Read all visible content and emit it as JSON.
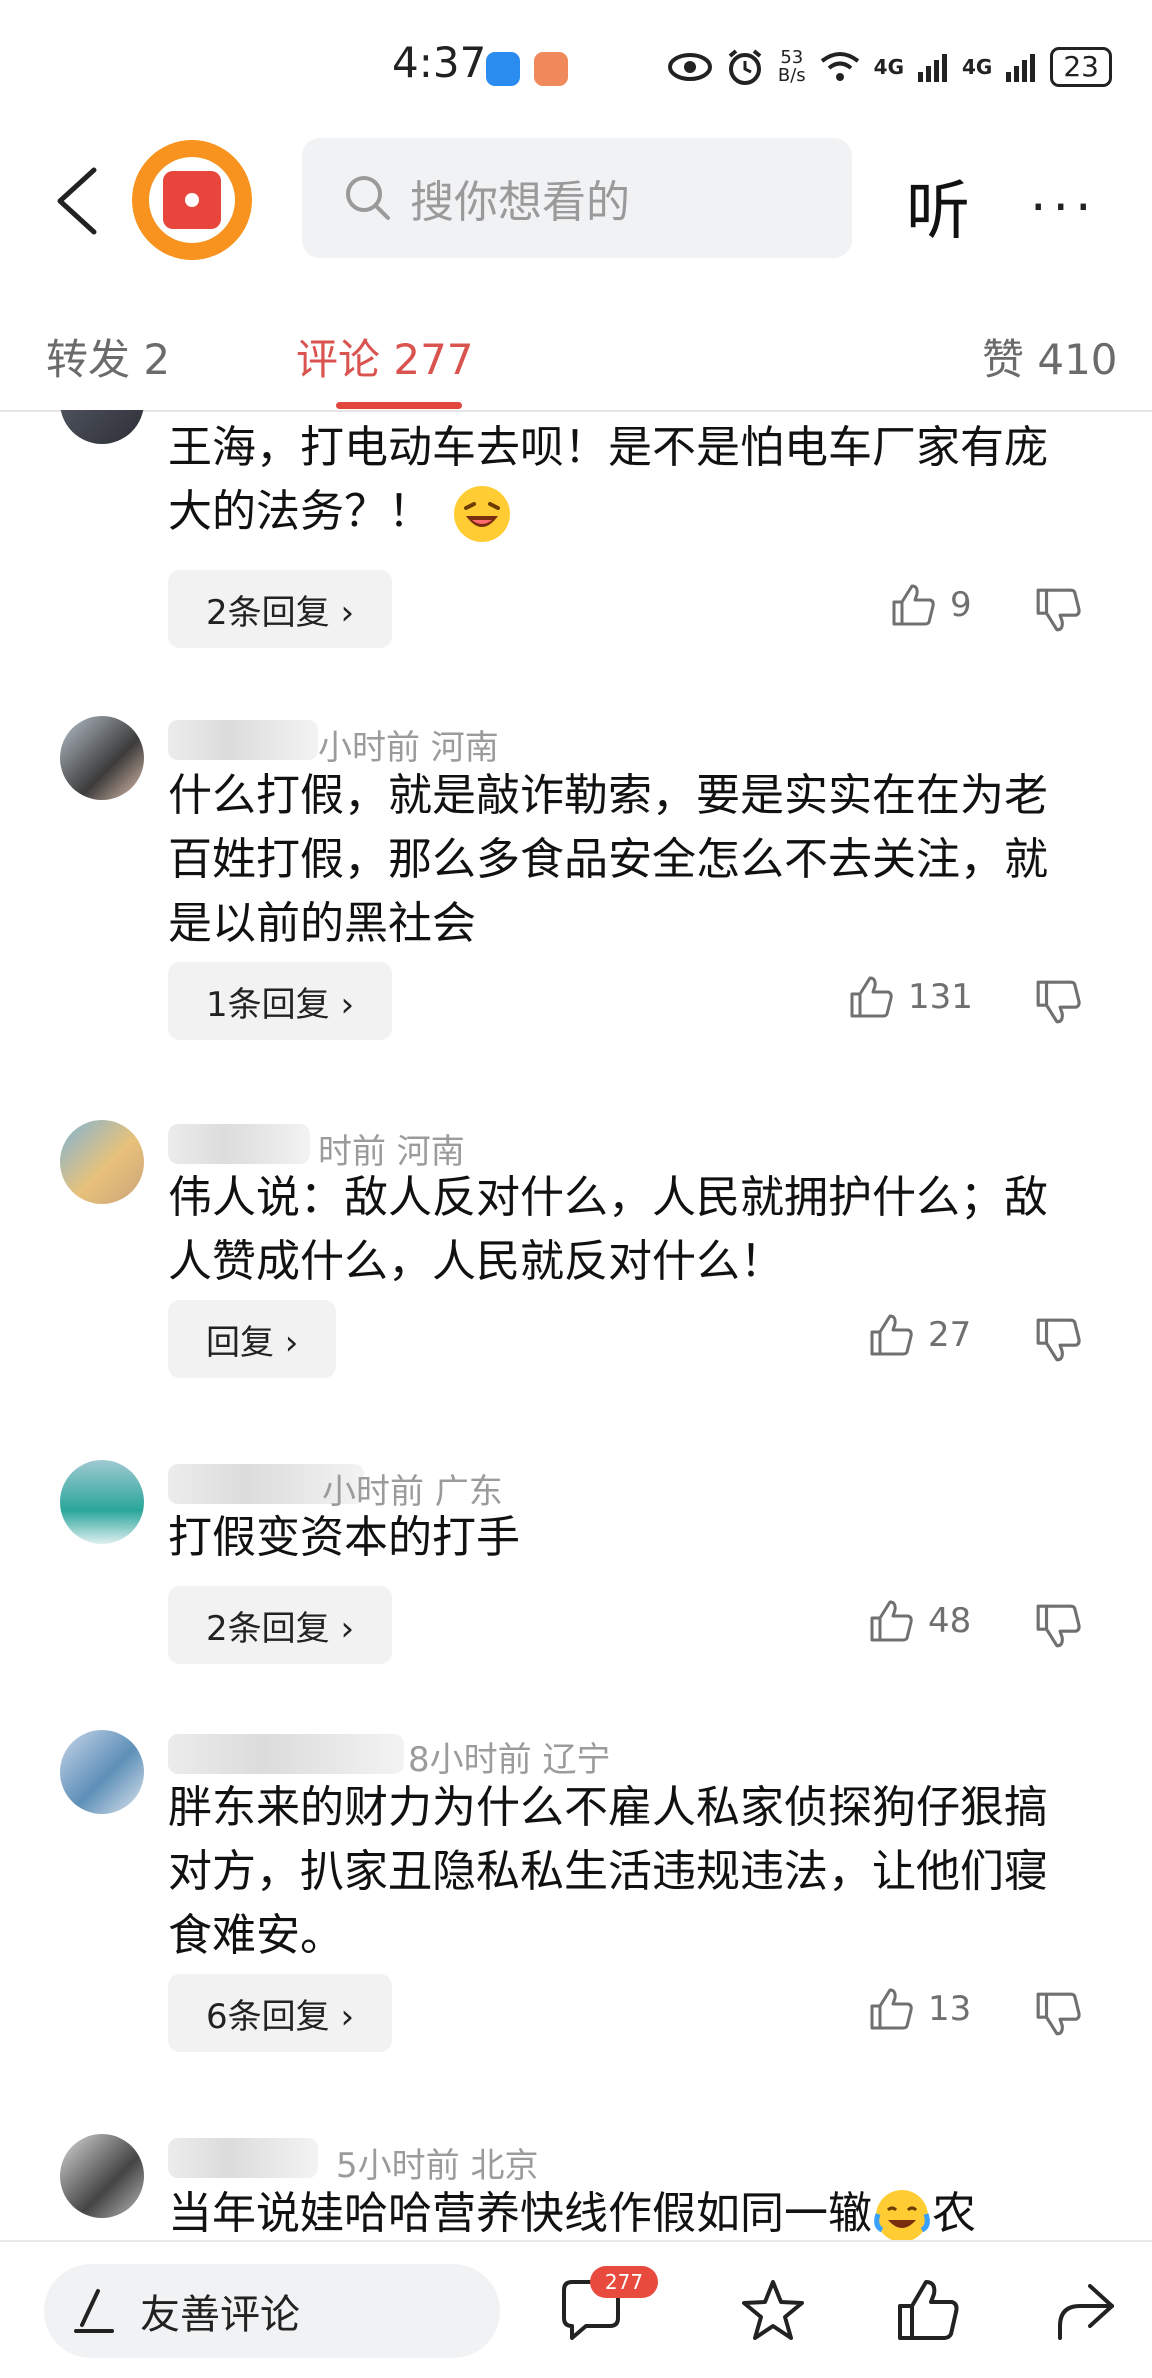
{
  "status_bar": {
    "time": "4:37",
    "speed_value": "53",
    "speed_unit": "B/s",
    "net1": "4G",
    "net2": "4G",
    "battery": "23"
  },
  "header": {
    "search_placeholder": "搜你想看的",
    "listen_label": "听",
    "more_label": "···"
  },
  "tabs": [
    {
      "label": "转发 2"
    },
    {
      "label": "评论 277"
    },
    {
      "label": "赞 410"
    }
  ],
  "comments": [
    {
      "meta": "",
      "text": "王海，打电动车去呗！是不是怕电车厂家有庞大的法务？！",
      "has_emoji": true,
      "reply": "2条回复 ›",
      "likes": "9"
    },
    {
      "meta": "小时前 河南",
      "text": "什么打假，就是敲诈勒索，要是实实在在为老百姓打假，那么多食品安全怎么不去关注，就是以前的黑社会",
      "reply": "1条回复 ›",
      "likes": "131"
    },
    {
      "meta": "时前 河南",
      "text": "伟人说：敌人反对什么，人民就拥护什么；敌人赞成什么，人民就反对什么！",
      "reply": "回复 ›",
      "likes": "27"
    },
    {
      "meta": "小时前 广东",
      "text": "打假变资本的打手",
      "reply": "2条回复 ›",
      "likes": "48"
    },
    {
      "meta": "8小时前 辽宁",
      "text": "胖东来的财力为什么不雇人私家侦探狗仔狠搞对方，扒家丑隐私私生活违规违法，让他们寝食难安。",
      "reply": "6条回复 ›",
      "likes": "13"
    },
    {
      "meta": "5小时前 北京",
      "text": "当年说娃哈哈营养快线作假如同一辙",
      "text_tail": "农",
      "reply": "",
      "likes": ""
    }
  ],
  "bottom_bar": {
    "comment_placeholder": "友善评论",
    "comment_count": "277"
  },
  "colors": {
    "accent": "#e2473e",
    "logo_ring": "#f7931e",
    "muted_text": "#9b9b9b"
  }
}
